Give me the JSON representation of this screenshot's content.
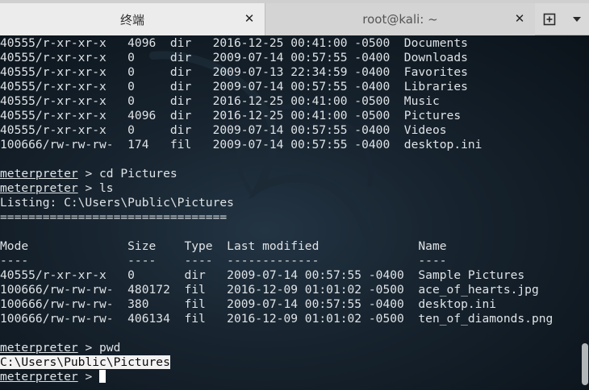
{
  "tabs": [
    {
      "title": "终端",
      "active": true
    },
    {
      "title": "root@kali: ~",
      "active": false
    }
  ],
  "icons": {
    "close": "close-icon",
    "new_tab": "new-tab-icon",
    "menu": "chevron-down-icon"
  },
  "terminal": {
    "lines": [
      "40555/r-xr-xr-x   4096  dir   2016-12-25 00:41:00 -0500  Documents",
      "40555/r-xr-xr-x   0     dir   2009-07-14 00:57:55 -0400  Downloads",
      "40555/r-xr-xr-x   0     dir   2009-07-13 22:34:59 -0400  Favorites",
      "40555/r-xr-xr-x   0     dir   2009-07-14 00:57:55 -0400  Libraries",
      "40555/r-xr-xr-x   0     dir   2016-12-25 00:41:00 -0500  Music",
      "40555/r-xr-xr-x   4096  dir   2016-12-25 00:41:00 -0500  Pictures",
      "40555/r-xr-xr-x   0     dir   2009-07-14 00:57:55 -0400  Videos",
      "100666/rw-rw-rw-  174   fil   2009-07-14 00:57:55 -0400  desktop.ini",
      "",
      "",
      "",
      "Listing: C:\\Users\\Public\\Pictures",
      "================================",
      "",
      "Mode              Size    Type  Last modified              Name",
      "----              ----    ----  -------------              ----",
      "40555/r-xr-xr-x   0       dir   2009-07-14 00:57:55 -0400  Sample Pictures",
      "100666/rw-rw-rw-  480172  fil   2016-12-09 01:01:02 -0500  ace_of_hearts.jpg",
      "100666/rw-rw-rw-  380     fil   2009-07-14 00:57:55 -0400  desktop.ini",
      "100666/rw-rw-rw-  406134  fil   2016-12-09 01:01:02 -0500  ten_of_diamonds.png",
      "",
      "",
      "",
      ""
    ],
    "prompt_label": "meterpreter",
    "prompt_sep": " > ",
    "cmd1": "cd Pictures",
    "cmd2": "ls",
    "cmd3": "pwd",
    "pwd_output": "C:\\Users\\Public\\Pictures"
  },
  "colors": {
    "terminal_text": "#dfe3e6",
    "terminal_bg": "#0e1820",
    "selection_bg": "#f2f2f2"
  }
}
